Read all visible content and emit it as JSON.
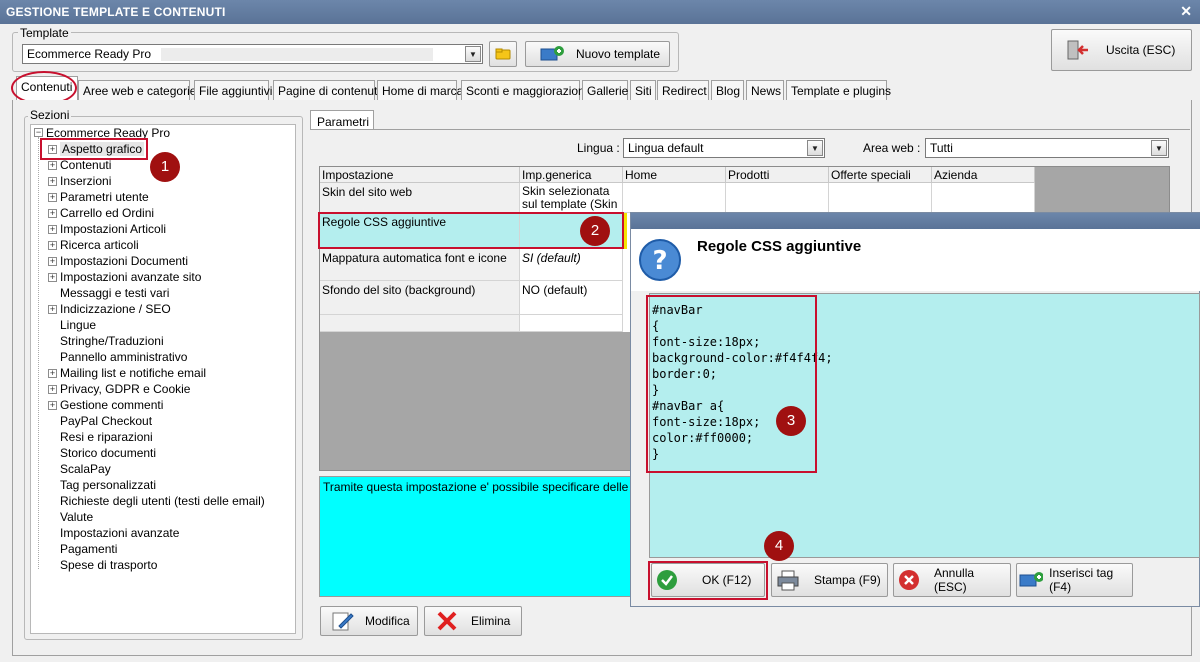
{
  "window": {
    "title": "GESTIONE TEMPLATE E CONTENUTI"
  },
  "template": {
    "group_label": "Template",
    "selected": "Ecommerce Ready Pro",
    "new_button": "Nuovo template",
    "exit_button": "Uscita (ESC)"
  },
  "tabs": [
    {
      "label": "Contenuti"
    },
    {
      "label": "Aree web e categorie"
    },
    {
      "label": "File aggiuntivi"
    },
    {
      "label": "Pagine di contenuti"
    },
    {
      "label": "Home di marca"
    },
    {
      "label": "Sconti e maggiorazioni"
    },
    {
      "label": "Gallerie"
    },
    {
      "label": "Siti"
    },
    {
      "label": "Redirect"
    },
    {
      "label": "Blog"
    },
    {
      "label": "News"
    },
    {
      "label": "Template e plugins"
    }
  ],
  "sections": {
    "group_label": "Sezioni",
    "root": "Ecommerce Ready Pro",
    "items": [
      {
        "label": "Aspetto grafico",
        "expandable": true
      },
      {
        "label": "Contenuti",
        "expandable": true
      },
      {
        "label": "Inserzioni",
        "expandable": true
      },
      {
        "label": "Parametri utente",
        "expandable": true
      },
      {
        "label": "Carrello ed Ordini",
        "expandable": true
      },
      {
        "label": "Impostazioni Articoli",
        "expandable": true
      },
      {
        "label": "Ricerca articoli",
        "expandable": true
      },
      {
        "label": "Impostazioni Documenti",
        "expandable": true
      },
      {
        "label": "Impostazioni avanzate sito",
        "expandable": true
      },
      {
        "label": "Messaggi e testi vari",
        "expandable": false
      },
      {
        "label": "Indicizzazione / SEO",
        "expandable": true
      },
      {
        "label": "Lingue",
        "expandable": false
      },
      {
        "label": "Stringhe/Traduzioni",
        "expandable": false
      },
      {
        "label": "Pannello amministrativo",
        "expandable": false
      },
      {
        "label": "Mailing list e notifiche email",
        "expandable": true
      },
      {
        "label": "Privacy, GDPR e Cookie",
        "expandable": true
      },
      {
        "label": "Gestione commenti",
        "expandable": true
      },
      {
        "label": "PayPal Checkout",
        "expandable": false
      },
      {
        "label": "Resi e riparazioni",
        "expandable": false
      },
      {
        "label": "Storico documenti",
        "expandable": false
      },
      {
        "label": "ScalaPay",
        "expandable": false
      },
      {
        "label": "Tag personalizzati",
        "expandable": false
      },
      {
        "label": "Richieste degli utenti (testi delle email)",
        "expandable": false
      },
      {
        "label": "Valute",
        "expandable": false
      },
      {
        "label": "Impostazioni avanzate",
        "expandable": false
      },
      {
        "label": "Pagamenti",
        "expandable": false
      },
      {
        "label": "Spese di trasporto",
        "expandable": false
      }
    ]
  },
  "params": {
    "tab_label": "Parametri",
    "lingua_label": "Lingua :",
    "lingua_value": "Lingua default",
    "area_label": "Area web :",
    "area_value": "Tutti",
    "columns": [
      "Impostazione",
      "Imp.generica",
      "Home",
      "Prodotti",
      "Offerte speciali",
      "Azienda"
    ],
    "rows": [
      {
        "setting": "Skin del sito web",
        "generic": "Skin selezionata sul template (Skin ba…"
      },
      {
        "setting": "Regole CSS aggiuntive",
        "generic": ""
      },
      {
        "setting": "Mappatura automatica font e icone",
        "generic": "SI (default)"
      },
      {
        "setting": "Sfondo del sito (background)",
        "generic": "NO (default)"
      }
    ],
    "description": "Tramite questa impostazione e' possibile specificare delle regole C",
    "modify_button": "Modifica",
    "delete_button": "Elimina"
  },
  "dialog": {
    "title": "Regole CSS aggiuntive",
    "code": "#navBar\n{\nfont-size:18px;\nbackground-color:#f4f4f4;\nborder:0;\n}\n#navBar a{\nfont-size:18px;\ncolor:#ff0000;\n}",
    "ok_button": "OK (F12)",
    "print_button": "Stampa (F9)",
    "cancel_button": "Annulla (ESC)",
    "insert_tag_button": "Inserisci tag (F4)"
  },
  "badges": [
    "1",
    "2",
    "3",
    "4"
  ],
  "colors": {
    "accent_red": "#c8102e",
    "cyan_highlight": "#00ffff",
    "dialog_bg": "#b4eeee",
    "badge": "#a01010"
  }
}
